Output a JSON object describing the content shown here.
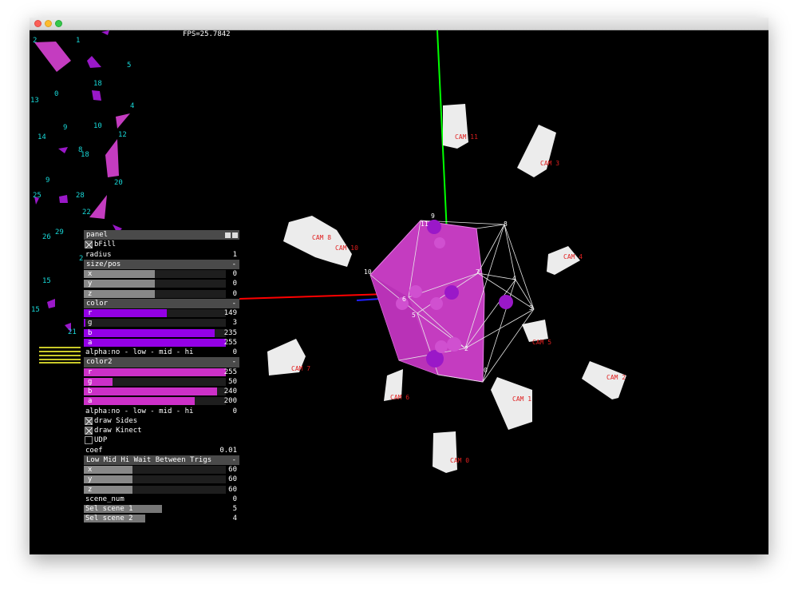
{
  "window": {
    "traffic_lights": [
      "close",
      "minimize",
      "maximize"
    ]
  },
  "fps_text": "FPS=25.7842",
  "axes": {
    "colors": {
      "x": "#ff0000",
      "y": "#00ff00",
      "z": "#0000ff"
    }
  },
  "cameras": [
    "CAM 0",
    "CAM 1",
    "CAM 2",
    "CAM 3",
    "CAM 4",
    "CAM 5",
    "CAM 6",
    "CAM 7",
    "CAM 8",
    "CAM 10",
    "CAM 11"
  ],
  "vertex_labels": [
    "0",
    "2",
    "3",
    "4",
    "5",
    "6",
    "7",
    "8",
    "9",
    "10",
    "11"
  ],
  "shape_labels": [
    "0",
    "1",
    "2",
    "4",
    "5",
    "8",
    "9",
    "9",
    "10",
    "12",
    "13",
    "14",
    "15",
    "15",
    "18",
    "18",
    "20",
    "21",
    "25",
    "26",
    "28",
    "29",
    "22",
    "2"
  ],
  "panel": {
    "title": "panel",
    "bfill_label": "bFill",
    "radius": {
      "label": "radius",
      "value": "1"
    },
    "size_pos": {
      "title": "size/pos",
      "collapse": "-",
      "x": {
        "label": "x",
        "value": "0"
      },
      "y": {
        "label": "y",
        "value": "0"
      },
      "z": {
        "label": "z",
        "value": "0"
      }
    },
    "color": {
      "title": "color",
      "collapse": "-",
      "r": {
        "label": "r",
        "value": "149"
      },
      "g": {
        "label": "g",
        "value": "3"
      },
      "b": {
        "label": "b",
        "value": "235"
      },
      "a": {
        "label": "a",
        "value": "255"
      },
      "fill_color": "#9400e6"
    },
    "alpha1": {
      "label": "alpha:no - low - mid  -  hi",
      "value": "0"
    },
    "color2": {
      "title": "color2",
      "collapse": "-",
      "r": {
        "label": "r",
        "value": "255"
      },
      "g": {
        "label": "g",
        "value": "50"
      },
      "b": {
        "label": "b",
        "value": "240"
      },
      "a": {
        "label": "a",
        "value": "200"
      },
      "fill_color": "#cc30c8"
    },
    "alpha2": {
      "label": "alpha:no - low - mid  -  hi",
      "value": "0"
    },
    "draw_sides": "draw Sides",
    "draw_kinect": "draw Kinect",
    "udp": "UDP",
    "coef": {
      "label": "coef",
      "value": "0.01"
    },
    "trigs": {
      "title": "Low Mid Hi Wait Between Trigs",
      "collapse": "-",
      "x": {
        "label": "x",
        "value": "60"
      },
      "y": {
        "label": "y",
        "value": "60"
      },
      "z": {
        "label": "z",
        "value": "60"
      }
    },
    "scene_num": {
      "label": "scene_num",
      "value": "0"
    },
    "sel1": {
      "label": "Sel scene 1",
      "value": "5"
    },
    "sel2": {
      "label": "Sel scene 2",
      "value": "4"
    }
  },
  "levels": {
    "sizepos": 0.5,
    "r": 0.585,
    "g": 0.012,
    "b": 0.92,
    "a": 1.0,
    "r2": 1.0,
    "g2": 0.2,
    "b2": 0.94,
    "a2": 0.78,
    "trigs": 0.34,
    "sel1": 0.55,
    "sel2": 0.43
  }
}
